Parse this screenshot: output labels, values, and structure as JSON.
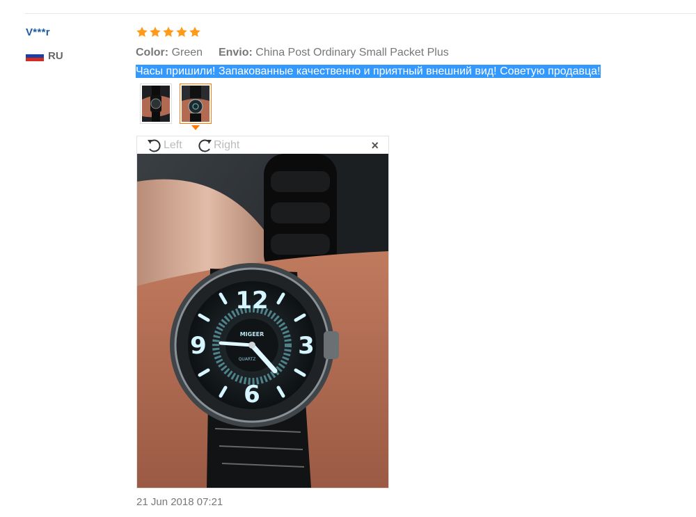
{
  "user": {
    "name": "V***r",
    "country": "RU"
  },
  "review": {
    "rating": 5,
    "color_label": "Color:",
    "color_value": "Green",
    "shipping_label": "Envio:",
    "shipping_value": "China Post Ordinary Small Packet Plus",
    "text": "Часы пришили! Запакованные качественно и приятный внешний вид! Советую продавца!",
    "thumbnail_count": 2,
    "selected_thumbnail": 2
  },
  "viewer": {
    "rotate_left_label": "Left",
    "rotate_right_label": "Right",
    "close_label": "×",
    "watch_brand": "MIGEER",
    "watch_sublabel": "QUARTZ"
  },
  "date": "21 Jun 2018 07:21",
  "colors": {
    "star": "#ff9a1a",
    "accent": "#ff7a00",
    "user_name": "#1d5aa8",
    "highlight": "#3399ff"
  }
}
